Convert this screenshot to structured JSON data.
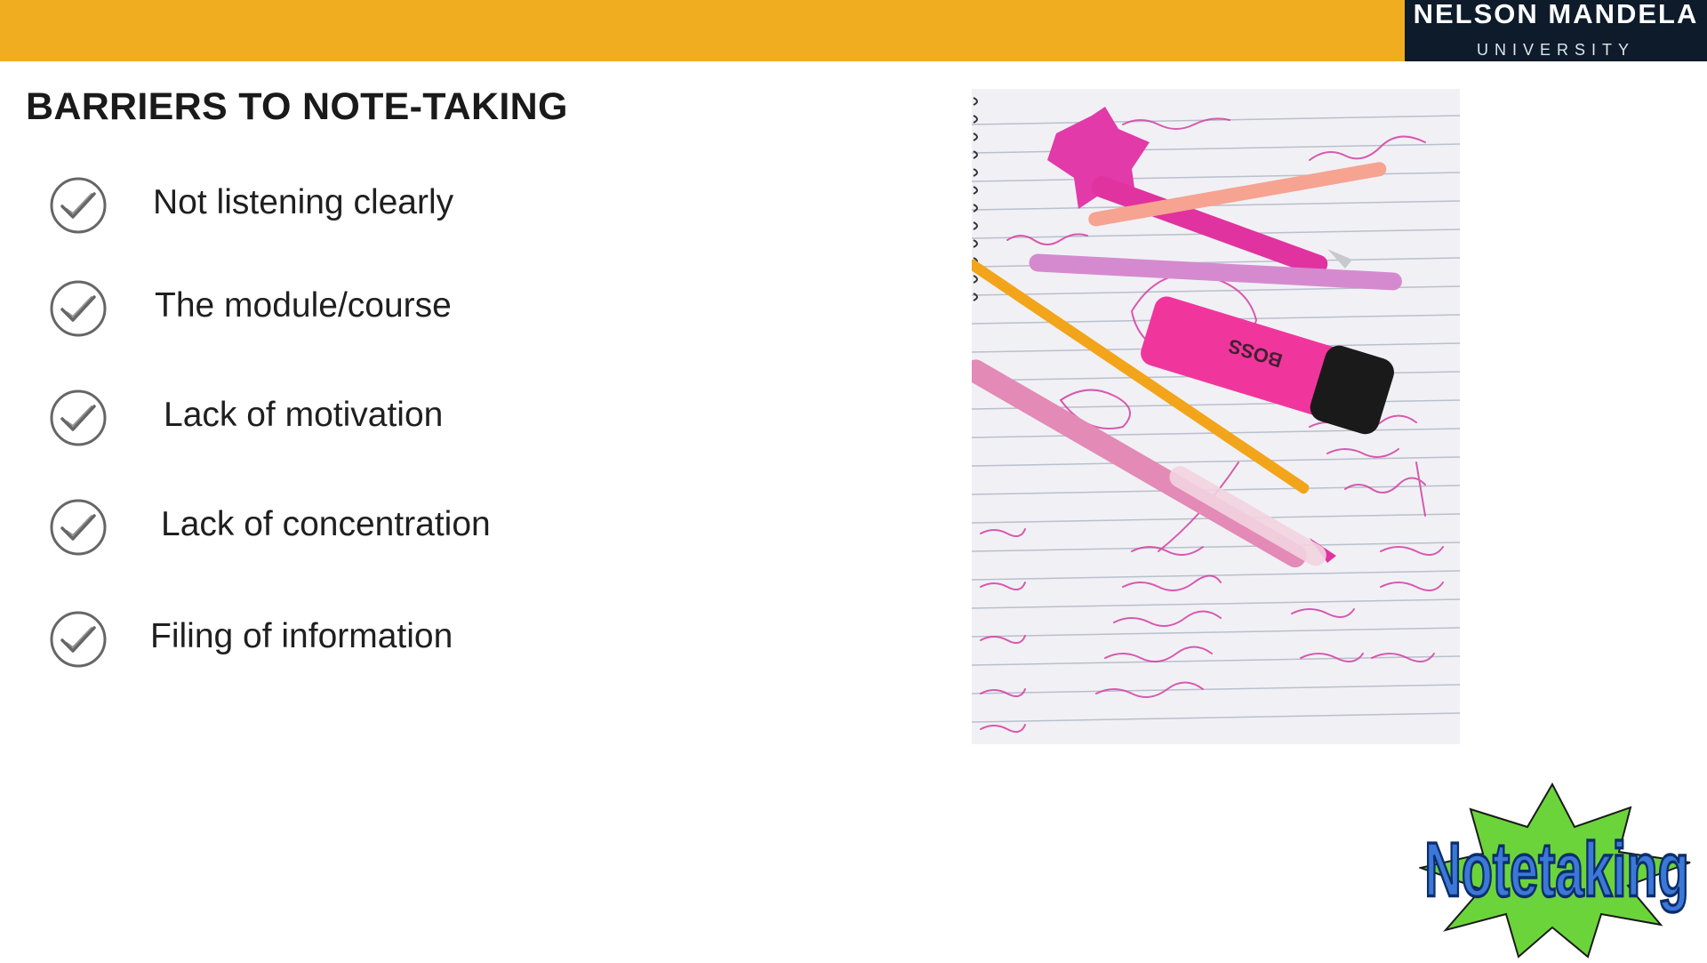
{
  "header": {
    "bar_color": "#f0ad1f",
    "logo": {
      "line1": "NELSON MANDELA",
      "line2": "UNIVERSITY",
      "background": "#0d1b2a"
    }
  },
  "slide": {
    "title": "BARRIERS TO NOTE-TAKING",
    "bullets": [
      {
        "label": "Not listening clearly",
        "icon": "checkmark-circle-icon"
      },
      {
        "label": "The module/course",
        "icon": "checkmark-circle-icon"
      },
      {
        "label": "Lack of motivation",
        "icon": "checkmark-circle-icon"
      },
      {
        "label": "Lack of concentration",
        "icon": "checkmark-circle-icon"
      },
      {
        "label": "Filing of information",
        "icon": "checkmark-circle-icon"
      }
    ]
  },
  "images": {
    "photo": {
      "subject": "pink-pens-on-notebook",
      "accent": "#e0338f"
    },
    "badge": {
      "text": "Notetaking",
      "star_color": "#66cc33",
      "text_color": "#3b78d8"
    }
  }
}
